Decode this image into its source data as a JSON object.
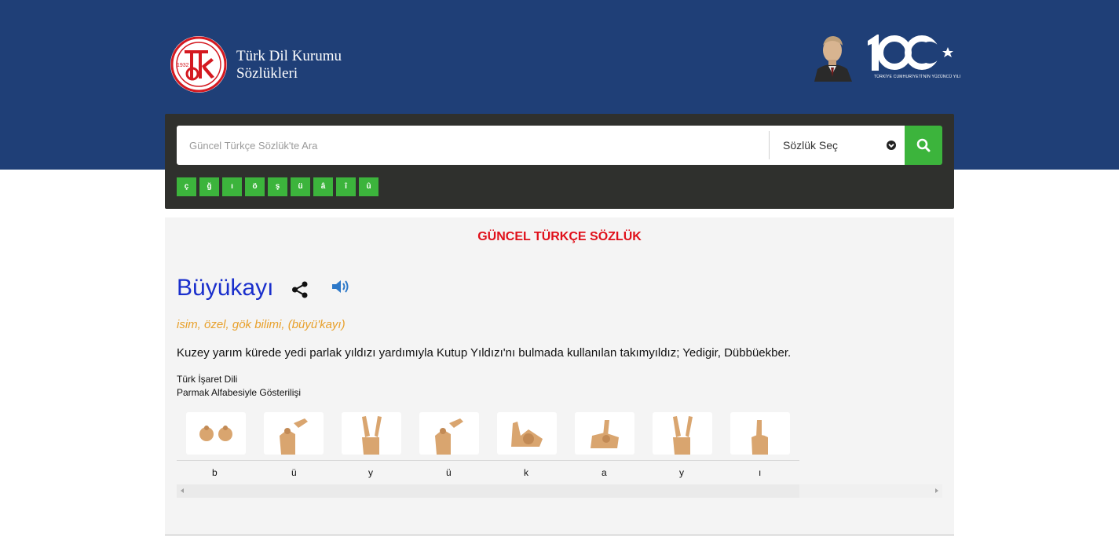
{
  "header": {
    "brand_line1": "Türk Dil Kurumu",
    "brand_line2": "Sözlükleri",
    "logo_year": "1932",
    "centennial_caption": "TÜRKİYE CUMHURİYETİ'NİN YÜZÜNCÜ YILI"
  },
  "search": {
    "placeholder": "Güncel Türkçe Sözlük'te Ara",
    "dictionary_select": "Sözlük Seç",
    "special_letters": [
      "ç",
      "ğ",
      "ı",
      "ö",
      "ş",
      "ü",
      "â",
      "î",
      "û"
    ]
  },
  "entry": {
    "dictionary_title": "GÜNCEL TÜRKÇE SÖZLÜK",
    "word": "Büyükayı",
    "meta": "isim, özel, gök bilimi, (büyü'kayı)",
    "definition": "Kuzey yarım kürede yedi parlak yıldızı yardımıyla Kutup Yıldızı'nı bulmada kullanılan takımyıldız; Yedigir, Dübbüekber.",
    "sign_language_title_line1": "Türk İşaret Dili",
    "sign_language_title_line2": "Parmak Alfabesiyle Gösterilişi",
    "finger_letters": [
      "b",
      "ü",
      "y",
      "ü",
      "k",
      "a",
      "y",
      "ı"
    ]
  },
  "colors": {
    "header_bg": "#1f3f77",
    "accent_green": "#3cb43c",
    "title_red": "#e0101a",
    "word_blue": "#1a2fcc",
    "meta_orange": "#e8a02b"
  }
}
